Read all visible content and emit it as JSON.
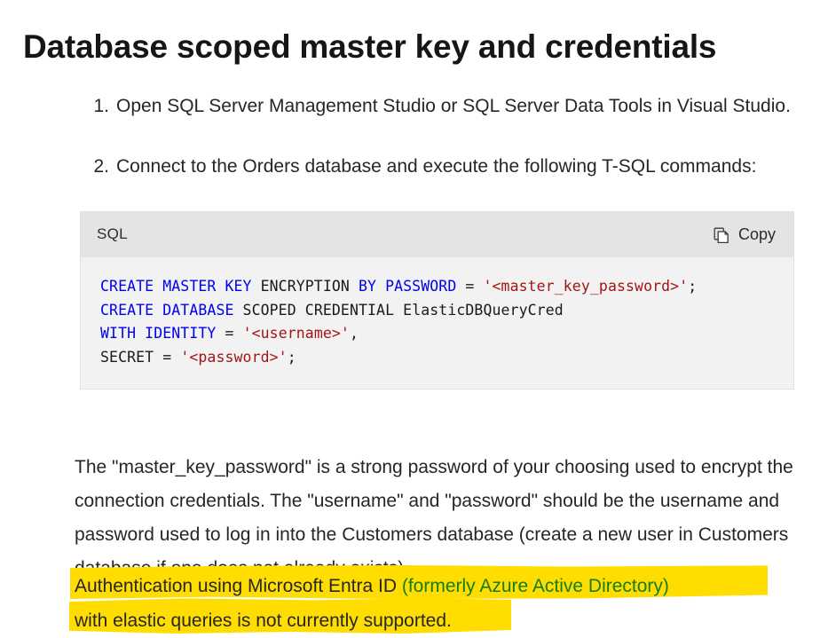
{
  "page": {
    "title": "Database scoped master key and credentials"
  },
  "steps": [
    {
      "marker": "1.",
      "text": "Open SQL Server Management Studio or SQL Server Data Tools in Visual Studio."
    },
    {
      "marker": "2.",
      "text": "Connect to the Orders database and execute the following T-SQL commands:"
    }
  ],
  "codeblock": {
    "language": "SQL",
    "copy_label": "Copy",
    "copy_icon": "copy-icon",
    "colors": {
      "keyword": "#0000f0",
      "string": "#a31515",
      "plain": "#1a1a1a",
      "header_background": "#e4e4e4",
      "body_background": "#f2f2f2"
    },
    "lines": [
      [
        {
          "t": "CREATE MASTER KEY ",
          "c": "kw"
        },
        {
          "t": "ENCRYPTION ",
          "c": "pln"
        },
        {
          "t": "BY PASSWORD ",
          "c": "kw"
        },
        {
          "t": "= ",
          "c": "pln"
        },
        {
          "t": "'<master_key_password>'",
          "c": "str"
        },
        {
          "t": ";",
          "c": "pln"
        }
      ],
      [
        {
          "t": "CREATE DATABASE ",
          "c": "kw"
        },
        {
          "t": "SCOPED CREDENTIAL ElasticDBQueryCred",
          "c": "pln"
        }
      ],
      [
        {
          "t": "WITH IDENTITY ",
          "c": "kw"
        },
        {
          "t": "= ",
          "c": "pln"
        },
        {
          "t": "'<username>'",
          "c": "str"
        },
        {
          "t": ",",
          "c": "pln"
        }
      ],
      [
        {
          "t": "SECRET = ",
          "c": "pln"
        },
        {
          "t": "'<password>'",
          "c": "str"
        },
        {
          "t": ";",
          "c": "pln"
        }
      ]
    ],
    "plain_text": "CREATE MASTER KEY ENCRYPTION BY PASSWORD = '<master_key_password>';\nCREATE DATABASE SCOPED CREDENTIAL ElasticDBQueryCred\nWITH IDENTITY = '<username>',\nSECRET = '<password>';"
  },
  "paragraph": "The \"master_key_password\" is a strong password of your choosing used to encrypt the connection credentials. The \"username\" and \"password\" should be the username and password used to log in into the Customers database (create a new user in Customers database if one does not already exists).",
  "note": {
    "line1_part1": "Authentication using Microsoft Entra ID ",
    "line1_part2": "(formerly Azure Active Directory)",
    "line2": "with elastic queries is not currently supported.",
    "highlight_color": "#ffdd00",
    "green_text_color": "#167d16"
  }
}
